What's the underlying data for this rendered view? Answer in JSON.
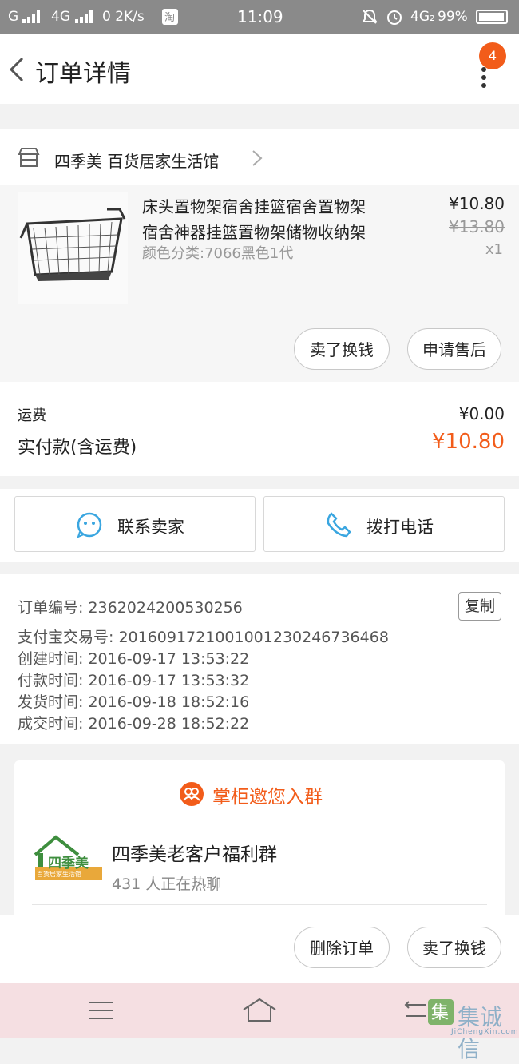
{
  "status_bar": {
    "carrier": "G",
    "network1": "4G",
    "network2": "4G",
    "speed": "0 2K/s",
    "time": "11:09",
    "network3": "4G₂",
    "battery": "99%"
  },
  "header": {
    "title": "订单详情",
    "badge_count": "4"
  },
  "shop": {
    "name": "四季美 百货居家生活馆"
  },
  "product": {
    "name_line1": "床头置物架宿舍挂篮宿舍置物架",
    "name_line2": "宿舍神器挂篮置物架储物收纳架",
    "sku": "颜色分类:7066黑色1代",
    "price": "¥10.80",
    "original_price": "¥13.80",
    "quantity": "x1",
    "btn_resell": "卖了换钱",
    "btn_aftersale": "申请售后"
  },
  "summary": {
    "shipping_label": "运费",
    "shipping_value": "¥0.00",
    "total_label": "实付款(含运费)",
    "total_value": "¥10.80"
  },
  "actions": {
    "contact_seller": "联系卖家",
    "call_phone": "拨打电话"
  },
  "order_info": {
    "order_no": "订单编号: 2362024200530256",
    "alipay_no": "支付宝交易号: 2016091721001001230246736468",
    "created": "创建时间: 2016-09-17  13:53:22",
    "paid": "付款时间: 2016-09-17  13:53:32",
    "shipped": "发货时间: 2016-09-18  18:52:16",
    "completed": "成交时间: 2016-09-28  18:52:22",
    "copy_label": "复制"
  },
  "group": {
    "invite_title": "掌柜邀您入群",
    "logo_text": "四季美",
    "logo_subtext": "百货居家生活馆",
    "name": "四季美老客户福利群",
    "members": "431 人正在热聊"
  },
  "bottom": {
    "delete_order": "删除订单",
    "resell": "卖了换钱"
  },
  "watermark": {
    "text": "集诚信",
    "sub": "JiChengXin.com"
  },
  "colors": {
    "accent": "#f25c1a",
    "status_bar": "#8a8a8a",
    "nav_bar": "#f5dfe2"
  }
}
